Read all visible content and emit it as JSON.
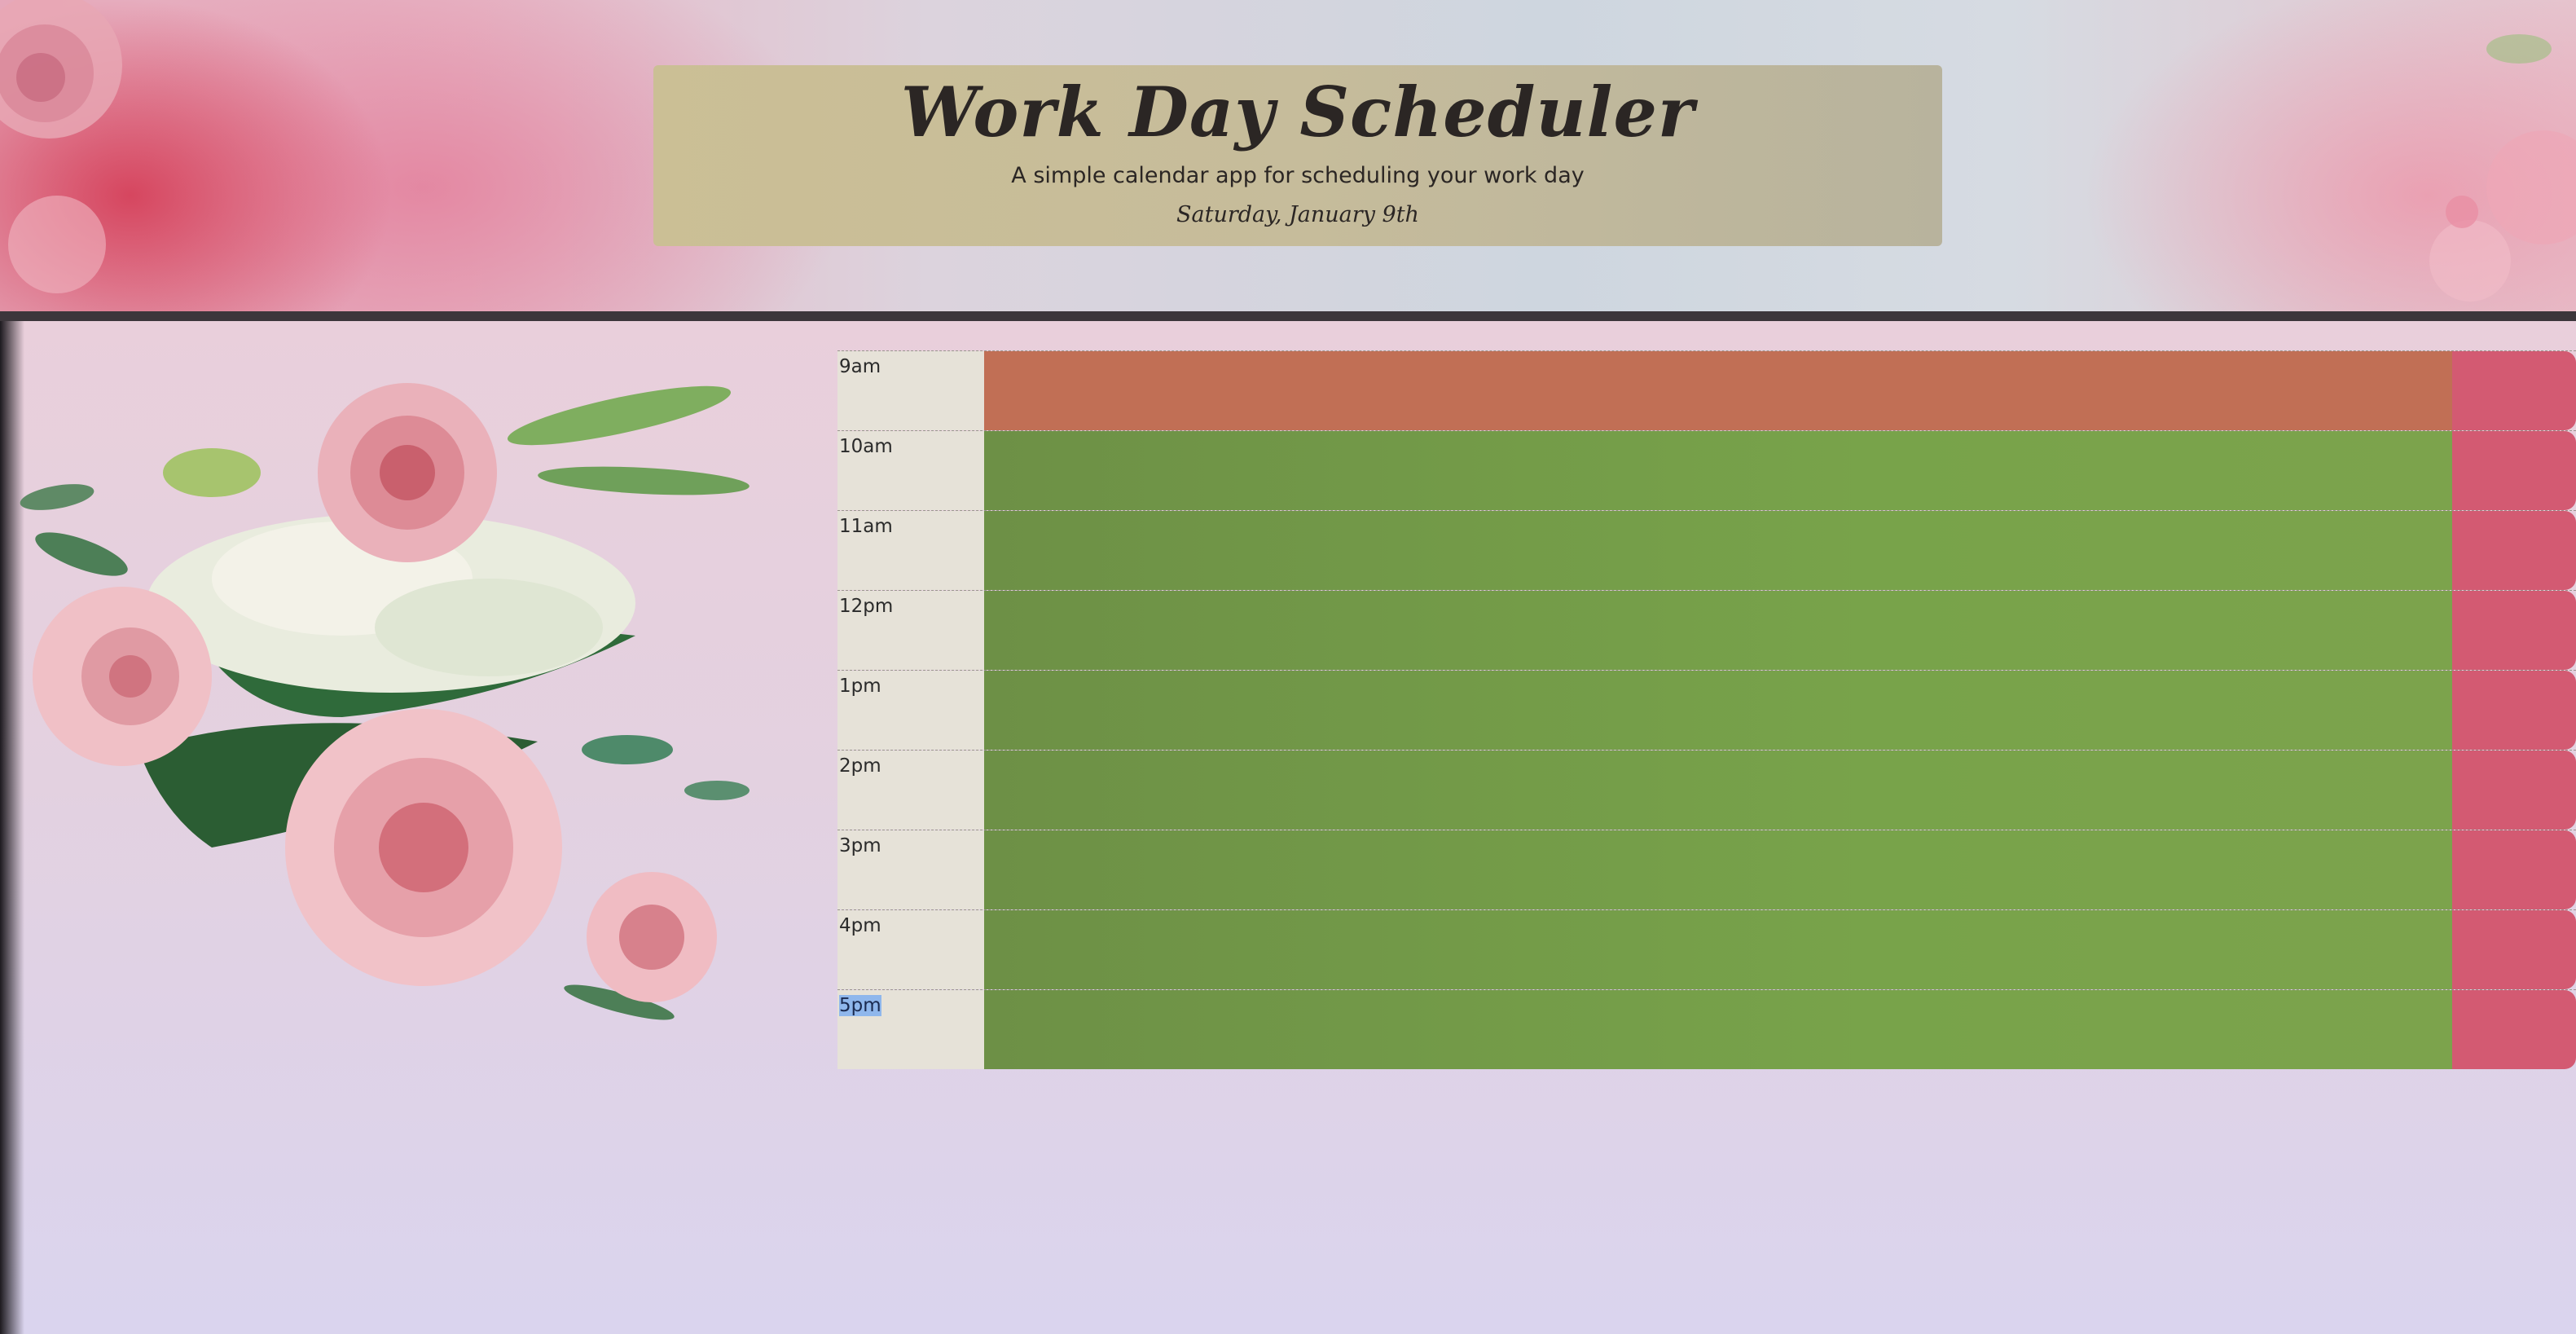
{
  "header": {
    "title": "Work Day Scheduler",
    "subtitle": "A simple calendar app for scheduling your work day",
    "current_day": "Saturday, January 9th"
  },
  "schedule": {
    "rows": [
      {
        "hour": "9am",
        "status": "past",
        "text": ""
      },
      {
        "hour": "10am",
        "status": "future",
        "text": ""
      },
      {
        "hour": "11am",
        "status": "future",
        "text": ""
      },
      {
        "hour": "12pm",
        "status": "future",
        "text": ""
      },
      {
        "hour": "1pm",
        "status": "future",
        "text": ""
      },
      {
        "hour": "2pm",
        "status": "future",
        "text": ""
      },
      {
        "hour": "3pm",
        "status": "future",
        "text": ""
      },
      {
        "hour": "4pm",
        "status": "future",
        "text": ""
      },
      {
        "hour": "5pm",
        "status": "future",
        "text": "",
        "label_selected": true
      }
    ]
  },
  "colors": {
    "past": "#c16f55",
    "future": "#78a34a",
    "save_button": "#d35a72",
    "title_card": "#c6bc9b"
  },
  "icons": {
    "save_button_icon": "save-icon"
  }
}
